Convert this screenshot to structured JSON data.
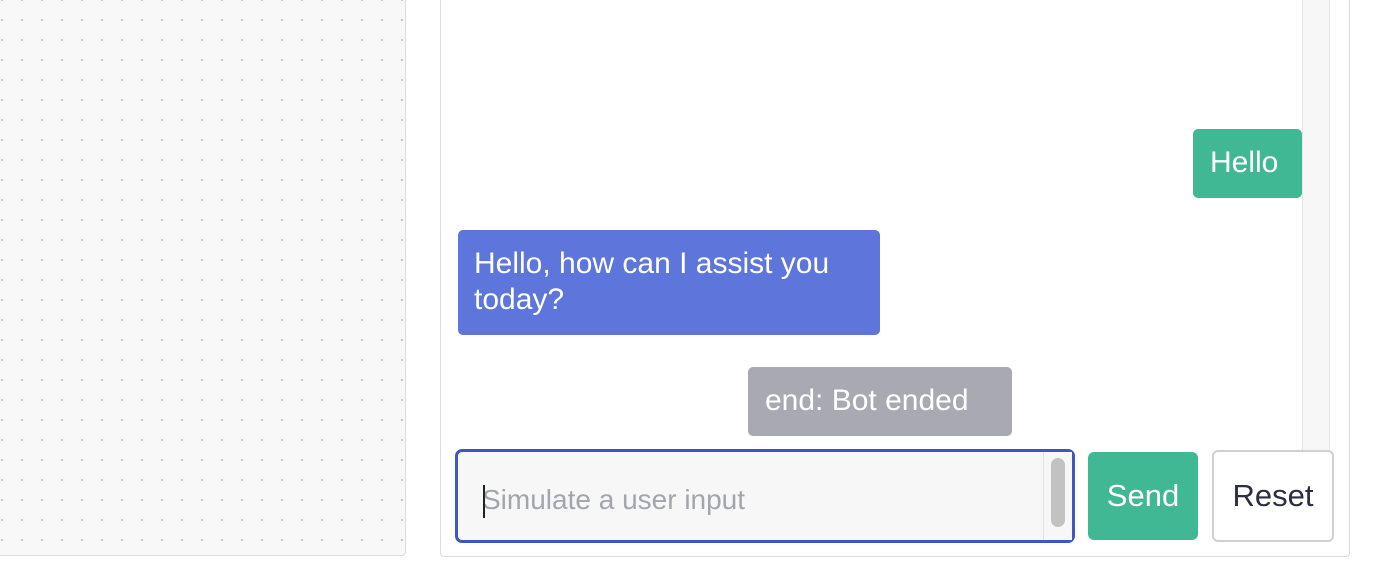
{
  "chat": {
    "messages": [
      {
        "role": "user",
        "text": "Hello"
      },
      {
        "role": "bot",
        "text": "Hello, how can I assist you today?"
      },
      {
        "role": "status",
        "text": "end: Bot ended"
      }
    ]
  },
  "composer": {
    "placeholder": "Simulate a user input",
    "value": ""
  },
  "actions": {
    "send_label": "Send",
    "reset_label": "Reset"
  },
  "colors": {
    "user_bubble": "#41b894",
    "bot_bubble": "#5e75db",
    "status_bubble": "#a8a9b3",
    "input_focus_border": "#3f55c0",
    "send_button": "#41b894"
  }
}
